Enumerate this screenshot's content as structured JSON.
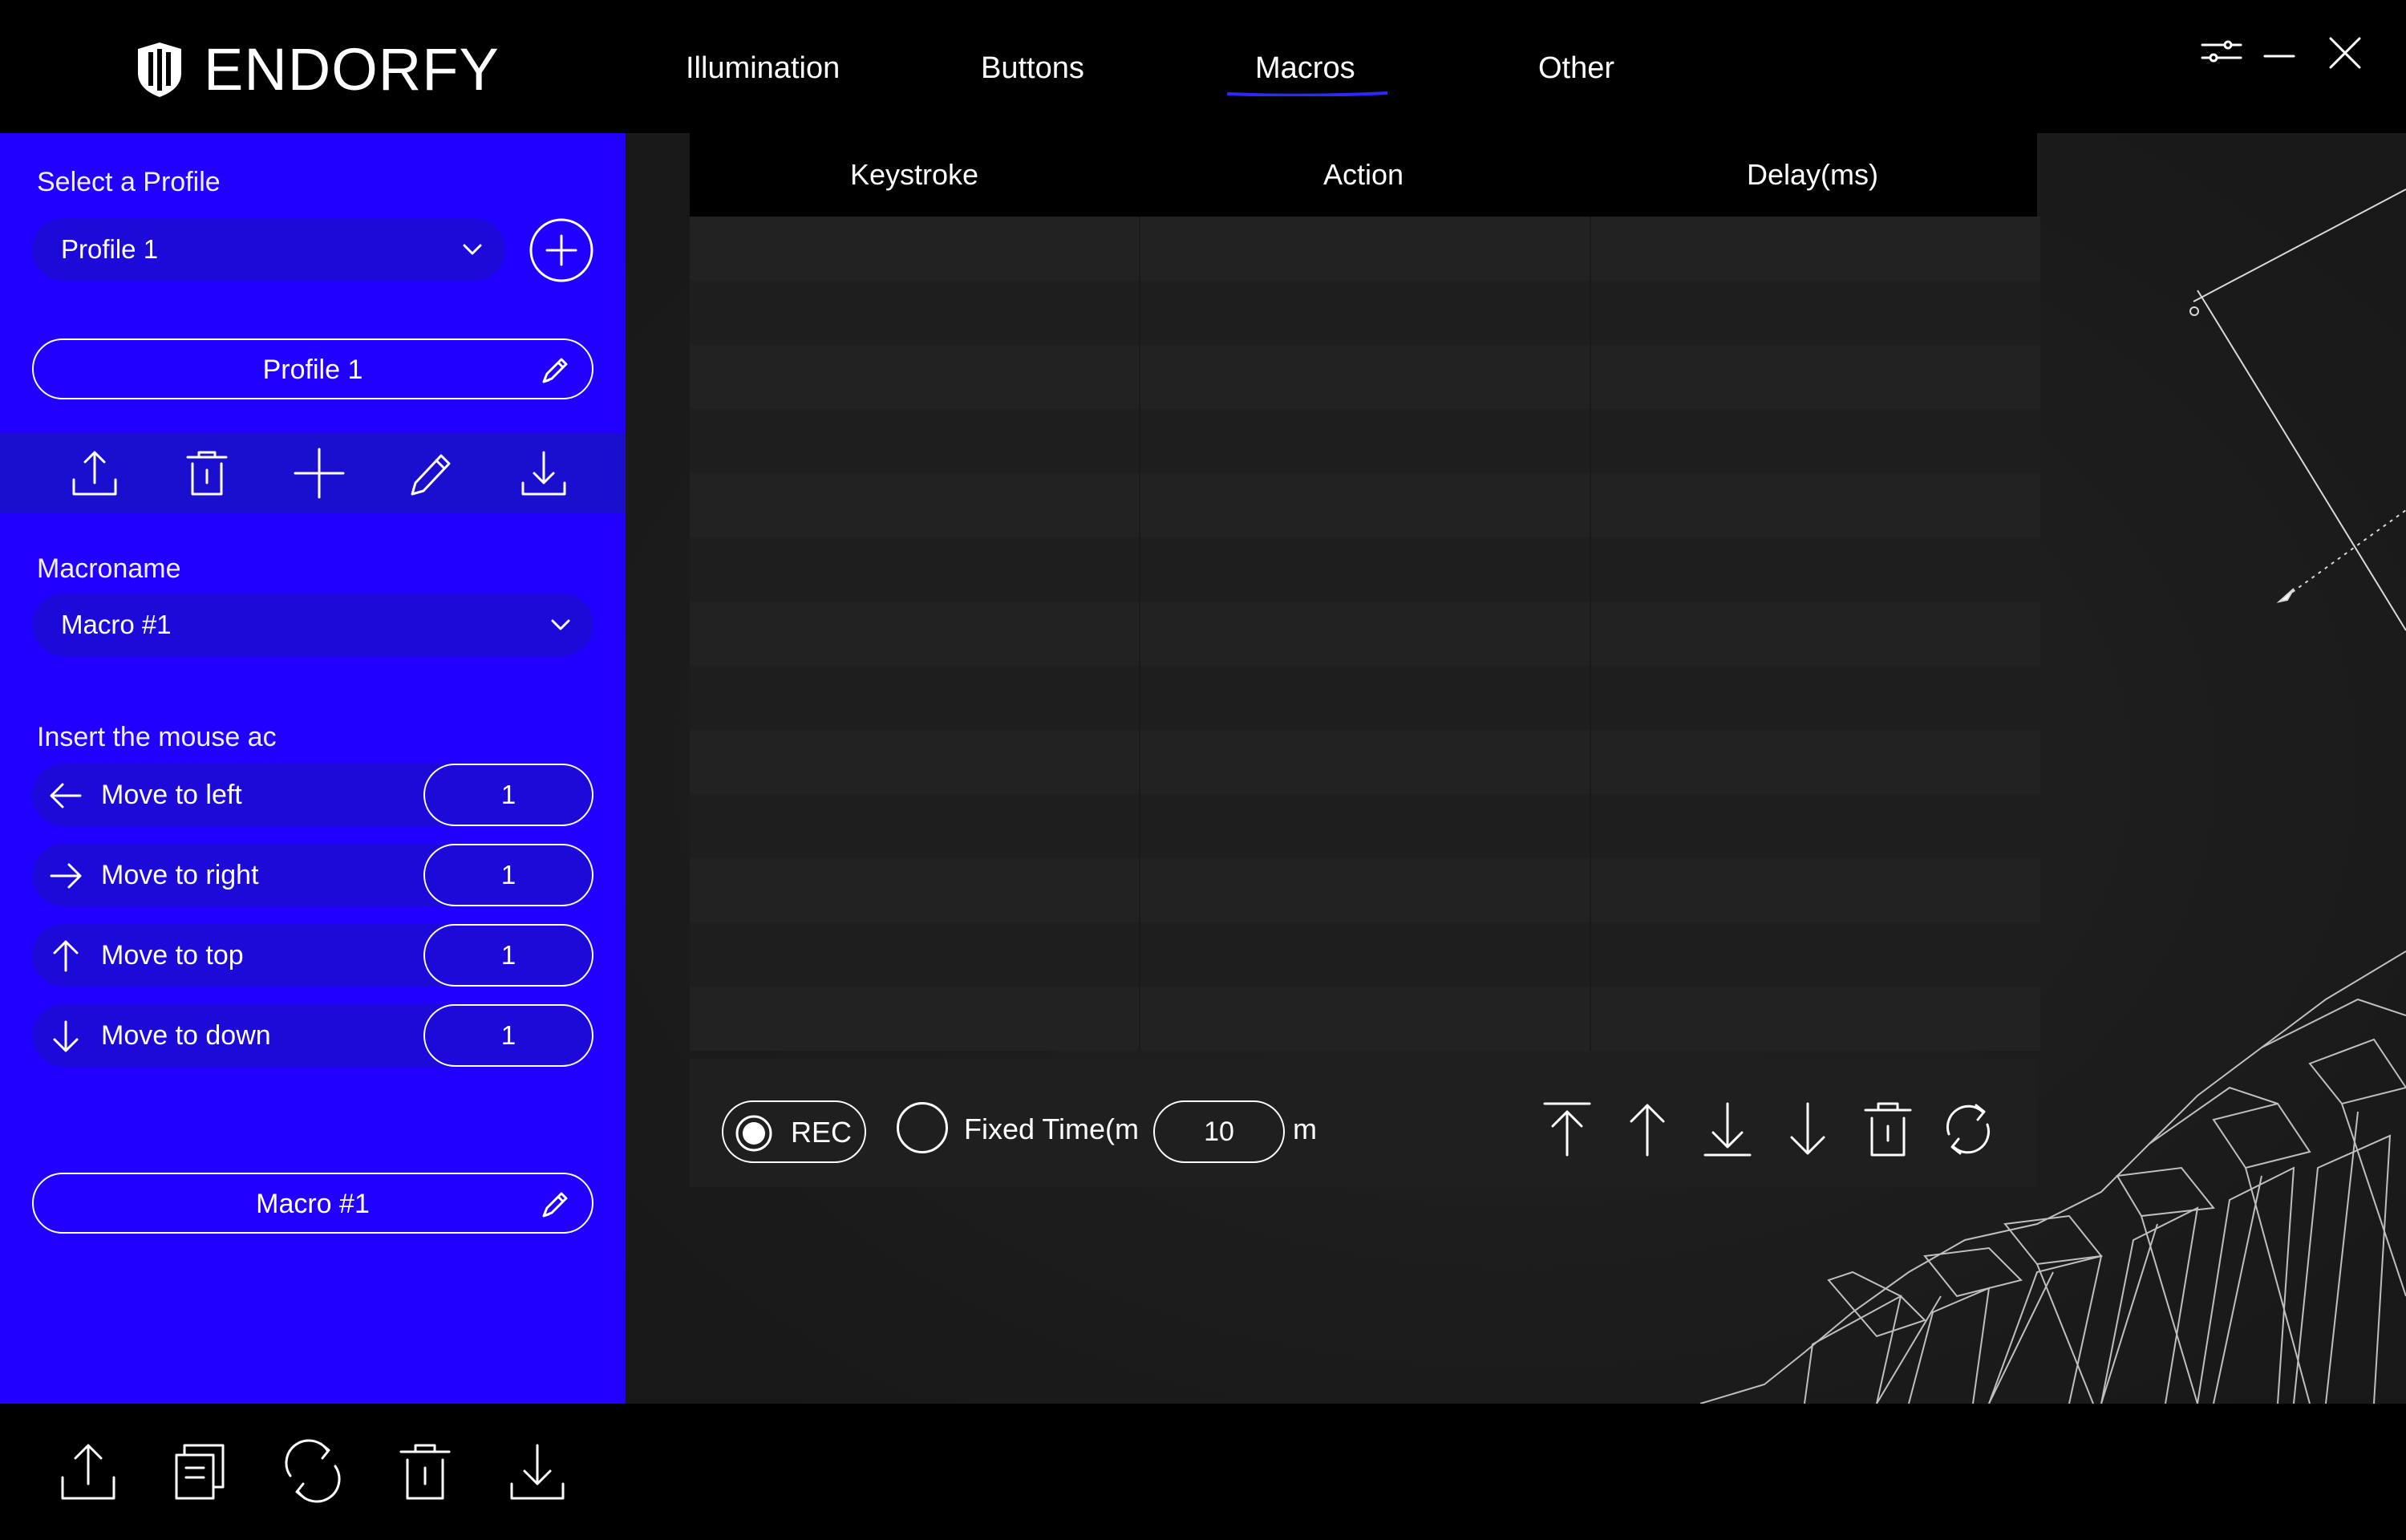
{
  "app": {
    "brand": "ENDORFY",
    "accent_color": "#2200ff",
    "nav": [
      "Illumination",
      "Buttons",
      "Macros",
      "Other"
    ],
    "active_tab": "Macros",
    "window_icons": [
      "sliders-icon",
      "minimize-icon",
      "close-icon"
    ]
  },
  "sidebar": {
    "profile_label": "Select a Profile",
    "profile_selected": "Profile 1",
    "profile_name": "Profile 1",
    "tools": [
      "export-icon",
      "trash-icon",
      "plus-icon",
      "pencil-icon",
      "import-icon"
    ],
    "macro_label": "Macroname",
    "macro_selected": "Macro #1",
    "mouse_label": "Insert the mouse ac",
    "moves": [
      {
        "label": "Move to left",
        "value": "1",
        "icon": "arrow-left-icon"
      },
      {
        "label": "Move to right",
        "value": "1",
        "icon": "arrow-right-icon"
      },
      {
        "label": "Move to top",
        "value": "1",
        "icon": "arrow-up-icon"
      },
      {
        "label": "Move to down",
        "value": "1",
        "icon": "arrow-down-icon"
      }
    ],
    "macro_name": "Macro #1"
  },
  "table": {
    "headers": [
      "Keystroke",
      "Action",
      "Delay(ms)"
    ],
    "rows": []
  },
  "controls": {
    "rec_label": "REC",
    "fixed_label": "Fixed Time(m",
    "fixed_value": "10",
    "unit": "m",
    "icons": [
      "move-to-top-icon",
      "move-up-icon",
      "move-to-bottom-icon",
      "move-down-icon",
      "delete-icon",
      "refresh-icon"
    ]
  },
  "bottom_bar": {
    "icons": [
      "export-icon",
      "copy-icon",
      "refresh-icon",
      "trash-icon",
      "import-icon"
    ]
  }
}
